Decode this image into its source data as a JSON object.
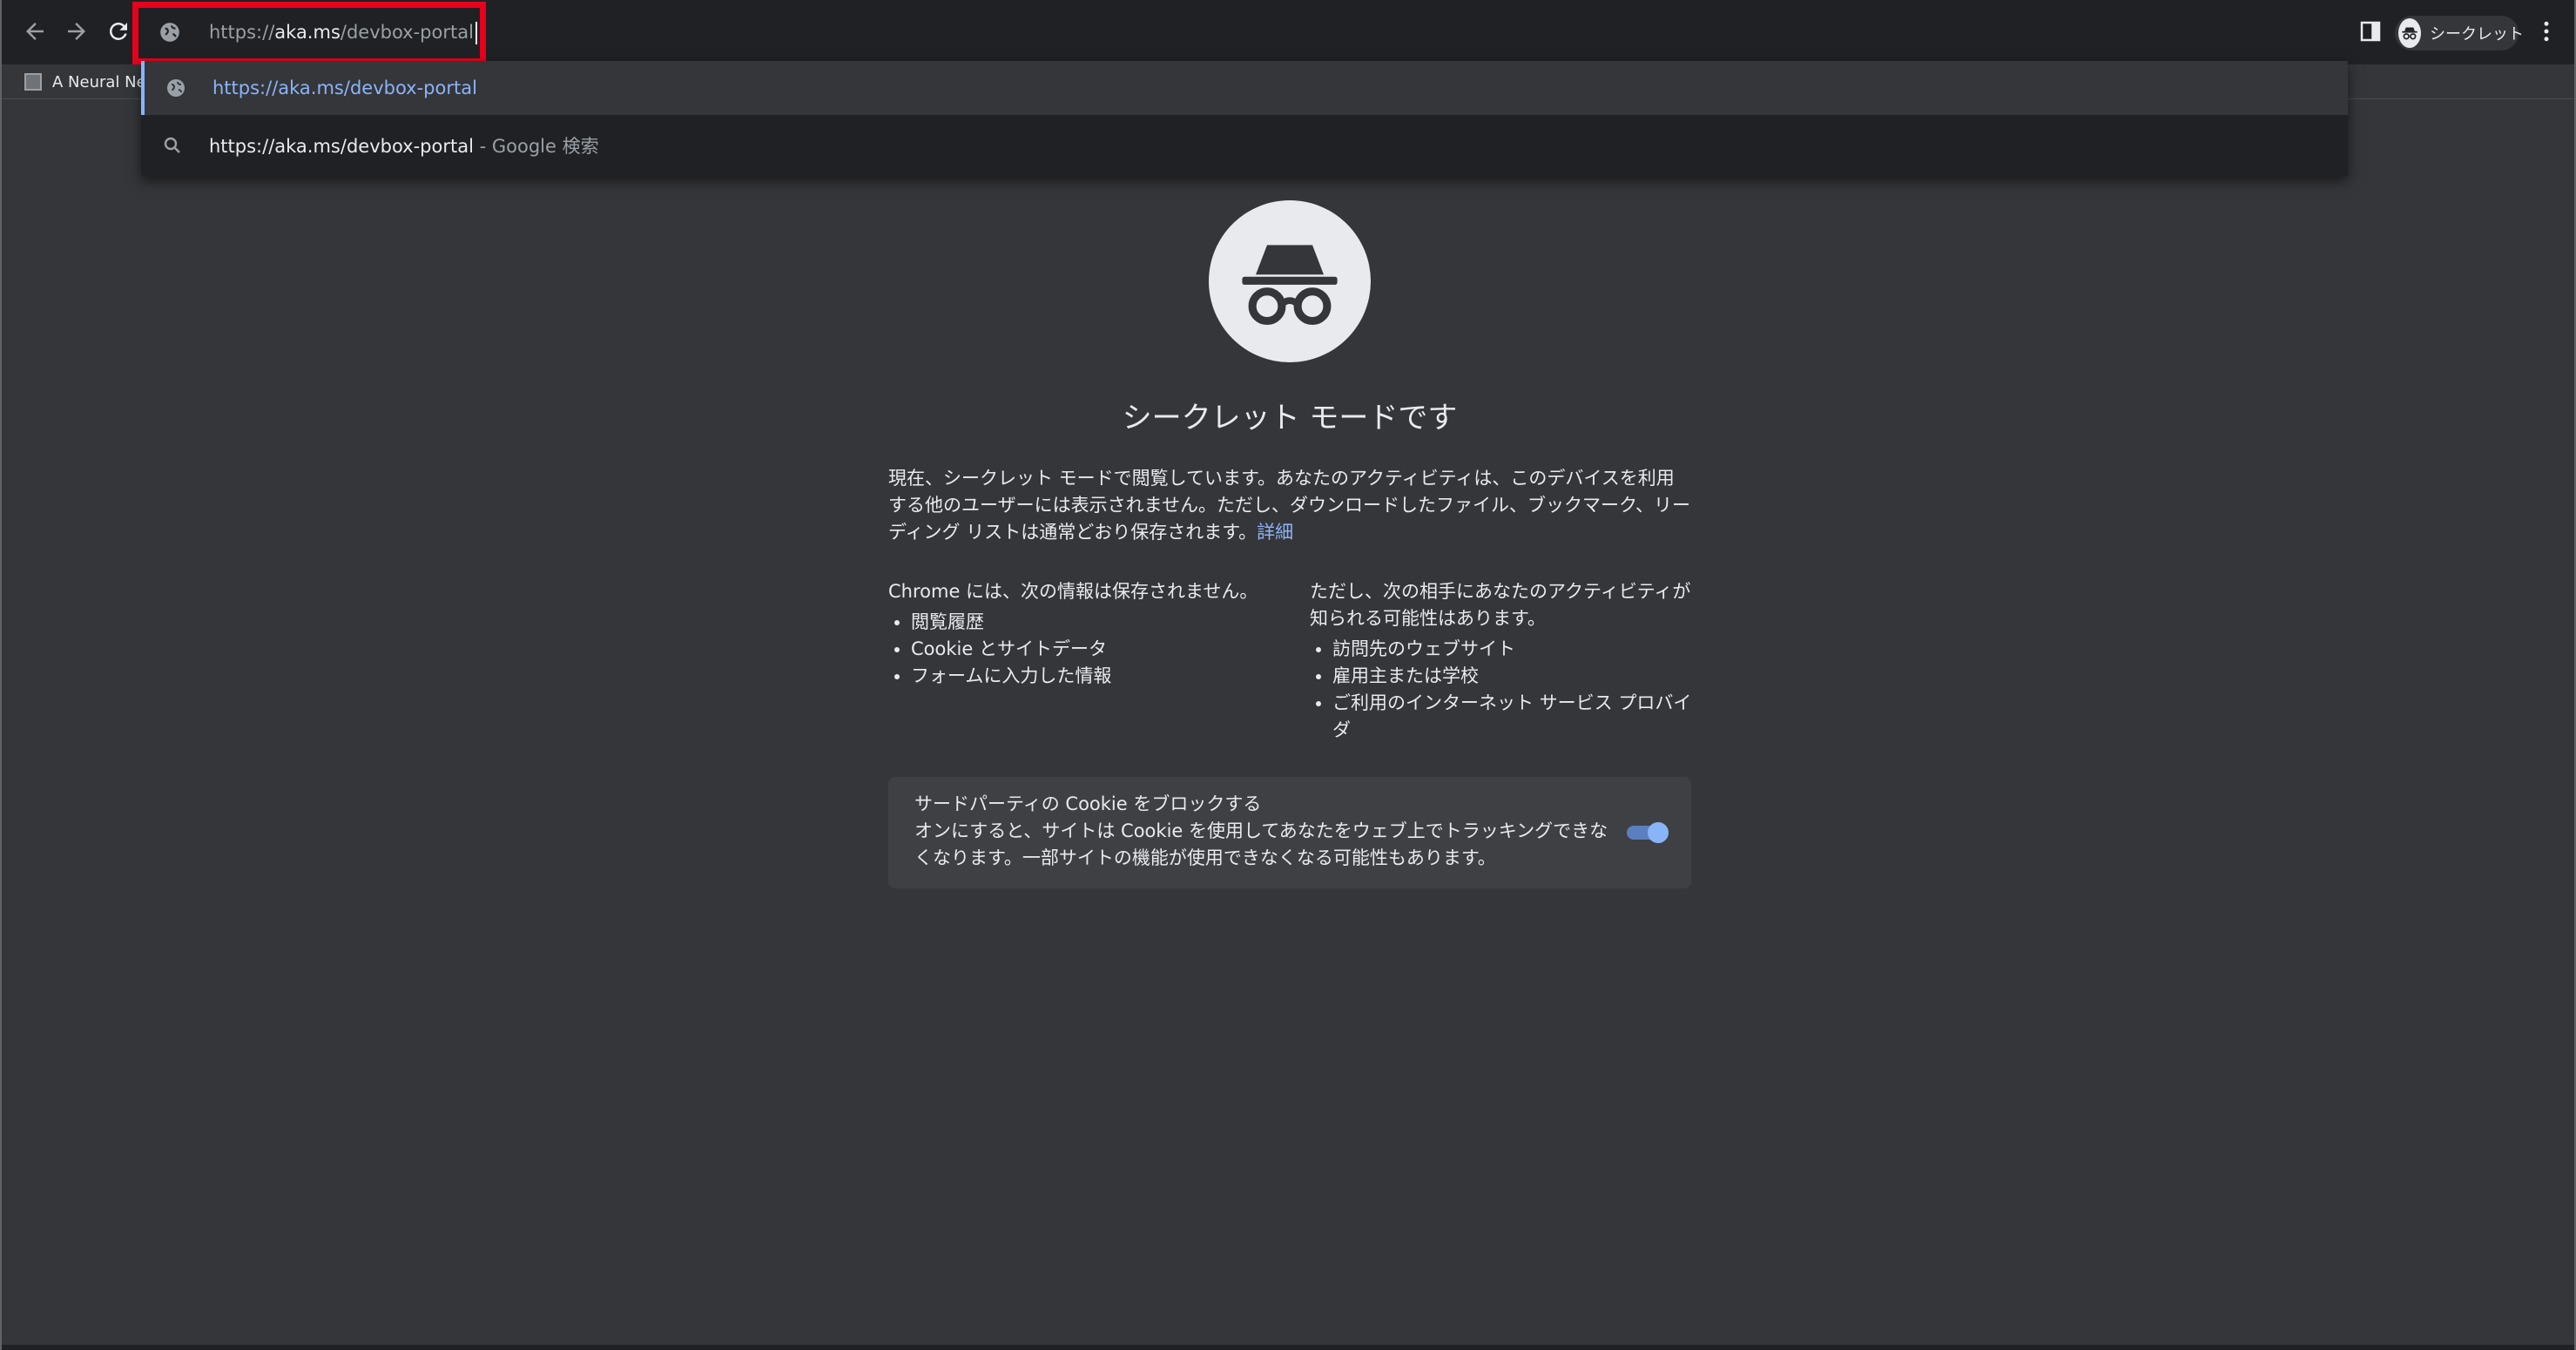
{
  "toolbar": {
    "back_icon": "arrow-left-icon",
    "forward_icon": "arrow-right-icon",
    "reload_icon": "reload-icon",
    "side_panel_icon": "side-panel-icon",
    "menu_icon": "kebab-menu-icon"
  },
  "omnibox": {
    "url_prefix": "https://",
    "url_host": "aka.ms",
    "url_path": "/devbox-portal",
    "site_icon": "globe-icon"
  },
  "suggestions": [
    {
      "icon": "globe-icon",
      "text": "https://aka.ms/devbox-portal"
    },
    {
      "icon": "search-icon",
      "text": "https://aka.ms/devbox-portal",
      "separator": " - ",
      "description": "Google 検索"
    }
  ],
  "profile": {
    "label": "シークレット",
    "icon": "incognito-icon"
  },
  "bookmarks": [
    {
      "label": "A Neural Ne"
    }
  ],
  "incognito": {
    "title": "シークレット モードです",
    "description": "現在、シークレット モードで閲覧しています。あなたのアクティビティは、このデバイスを利用する他のユーザーには表示されません。ただし、ダウンロードしたファイル、ブックマーク、リーディング リストは通常どおり保存されます。",
    "learn_more": "詳細",
    "not_saved_heading": "Chrome には、次の情報は保存されません。",
    "not_saved_items": [
      "閲覧履歴",
      "Cookie とサイトデータ",
      "フォームに入力した情報"
    ],
    "visible_heading": "ただし、次の相手にあなたのアクティビティが知られる可能性はあります。",
    "visible_items": [
      "訪問先のウェブサイト",
      "雇用主または学校",
      "ご利用のインターネット サービス プロバイダ"
    ],
    "cookie_card": {
      "title": "サードパーティの Cookie をブロックする",
      "description": "オンにすると、サイトは Cookie を使用してあなたをウェブ上でトラッキングできなくなります。一部サイトの機能が使用できなくなる可能性もあります。",
      "toggle_on": true
    }
  },
  "colors": {
    "toolbar_bg": "#202124",
    "page_bg": "#35363a",
    "accent_blue": "#8ab4f8",
    "highlight_red": "#e8001c"
  }
}
